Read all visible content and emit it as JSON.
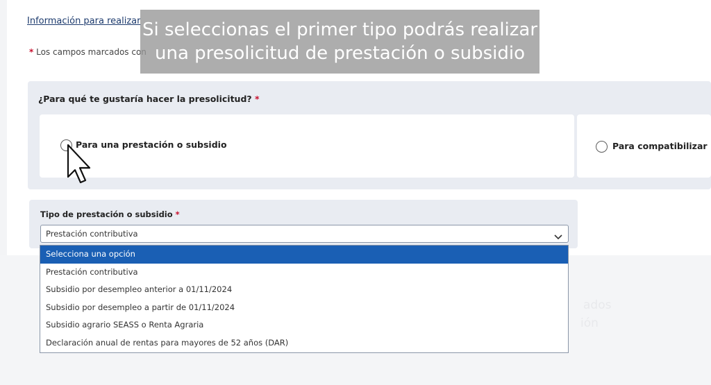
{
  "header": {
    "info_link": "Información para realizar",
    "required_note": "Los campos marcados con",
    "required_mark": "*"
  },
  "question": {
    "label": "¿Para qué te gustaría hacer la presolicitud?",
    "required_mark": "*",
    "options": [
      {
        "label": "Para una prestación o subsidio",
        "selected": false
      },
      {
        "label": "Para compatibilizar",
        "selected": false
      }
    ]
  },
  "benefit_type": {
    "label": "Tipo de prestación o subsidio",
    "required_mark": "*",
    "selected_value": "Prestación contributiva",
    "options": [
      "Selecciona una opción",
      "Prestación contributiva",
      "Subsidio por desempleo anterior a 01/11/2024",
      "Subsidio por desempleo a partir de 01/11/2024",
      "Subsidio agrario SEASS o Renta Agraria",
      "Declaración anual de rentas para mayores de 52 años (DAR)"
    ],
    "highlighted_option": "Selecciona una opción"
  },
  "background_text": {
    "line1": "ados",
    "line2": "ión"
  },
  "overlay_caption": {
    "line1": "Si seleccionas el primer tipo podrás realizar",
    "line2": "una presolicitud de prestación o subsidio"
  },
  "colors": {
    "required": "#c8102e",
    "highlight": "#1a5fb4",
    "section_bg": "#e9ecf2"
  },
  "icons": {
    "select_arrow": "chevron-down-icon",
    "pointer": "mouse-cursor-icon"
  }
}
